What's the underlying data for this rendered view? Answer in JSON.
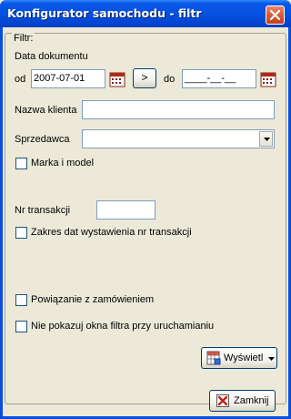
{
  "window": {
    "title": "Konfigurator samochodu - filtr"
  },
  "filter": {
    "group_label": "Filtr:",
    "document_date_label": "Data dokumentu",
    "from_label": "od",
    "from_value": "2007-07-01",
    "shift_button": ">",
    "to_label": "do",
    "to_value": "____-__-__",
    "client_name_label": "Nazwa klienta",
    "client_name_value": "",
    "seller_label": "Sprzedawca",
    "seller_value": "",
    "brand_model_label": "Marka i model",
    "brand_model_checked": false,
    "transaction_no_label": "Nr transakcji",
    "transaction_no_value": "",
    "date_range_label": "Zakres dat wystawienia nr transakcji",
    "date_range_checked": false,
    "order_link_label": "Powiązanie z zamówieniem",
    "order_link_checked": false,
    "hide_filter_label": "Nie pokazuj okna filtra przy uruchamianiu",
    "hide_filter_checked": false,
    "show_button_label": "Wyświetl",
    "show_button_icon": "grid-report-icon"
  },
  "footer": {
    "close_button_label": "Zamknij",
    "close_button_icon": "red-x-icon"
  },
  "colors": {
    "titlebar": "#0551e0",
    "dialog_bg": "#ece9d8",
    "close_red": "#d85a34"
  }
}
